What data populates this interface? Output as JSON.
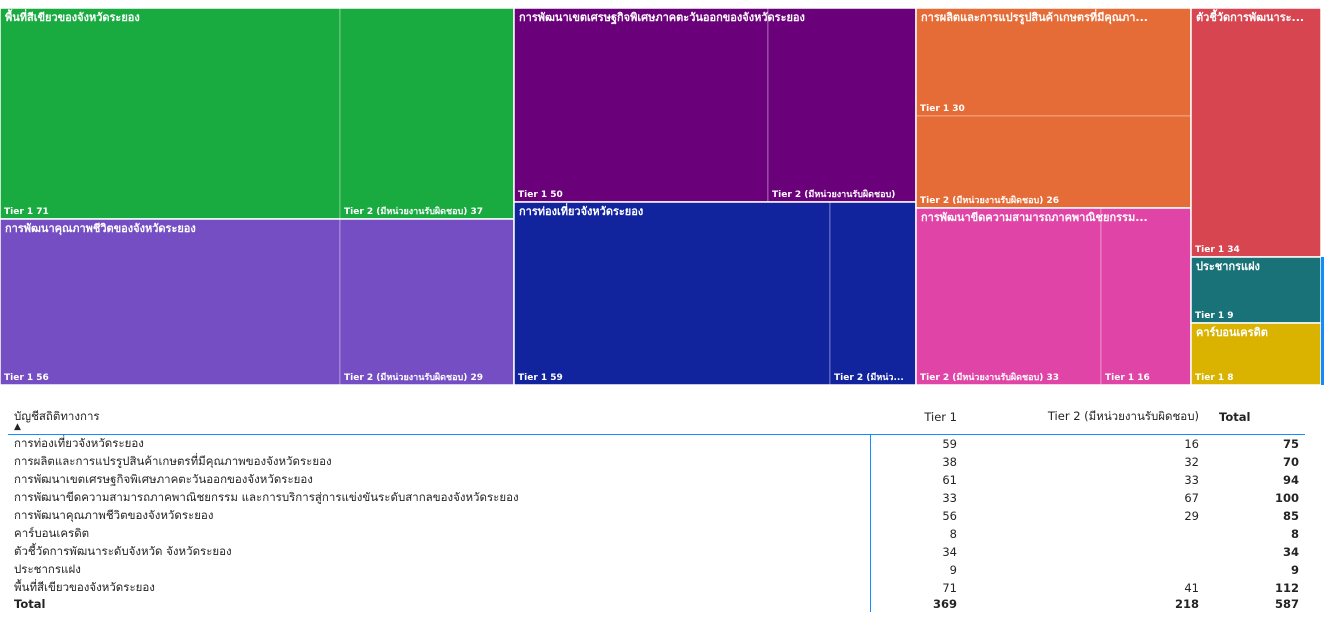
{
  "chart_data": [
    {
      "type": "treemap",
      "groups": [
        {
          "name": "พื้นที่สีเขียวของจังหวัดระยอง",
          "display_label": "พื้นที่สีเขียวของจังหวัดระยอง",
          "color": "#1aab40",
          "tiers": [
            {
              "label": "Tier 1 71",
              "value": 71
            },
            {
              "label": "Tier 2 (มีหน่วยงานรับผิดชอบ) 37",
              "value": 41
            }
          ]
        },
        {
          "name": "การพัฒนาคุณภาพชีวิตของจังหวัดระยอง",
          "display_label": "การพัฒนาคุณภาพชีวิตของจังหวัดระยอง",
          "color": "#744ec2",
          "tiers": [
            {
              "label": "Tier 1 56",
              "value": 56
            },
            {
              "label": "Tier 2 (มีหน่วยงานรับผิดชอบ) 29",
              "value": 29
            }
          ]
        },
        {
          "name": "การพัฒนาเขตเศรษฐกิจพิเศษภาคตะวันออกของจังหวัดระยอง",
          "display_label": "การพัฒนาเขตเศรษฐกิจพิเศษภาคตะวันออกของจังหวัดระยอง",
          "color": "#6b007b",
          "tiers": [
            {
              "label": "Tier 1 50",
              "value": 61
            },
            {
              "label": "Tier 2 (มีหน่วยงานรับผิดชอบ)",
              "value": 33
            }
          ]
        },
        {
          "name": "การท่องเที่ยวจังหวัดระยอง",
          "display_label": "การท่องเที่ยวจังหวัดระยอง",
          "color": "#12239e",
          "tiers": [
            {
              "label": "Tier 1 59",
              "value": 59
            },
            {
              "label": "Tier 2 (มีหน่ว...",
              "value": 16
            }
          ]
        },
        {
          "name": "การผลิตและการแปรรูปสินค้าเกษตรที่มีคุณภาพของจังหวัดระยอง",
          "display_label": "การผลิตและการแปรรูปสินค้าเกษตรที่มีคุณภา...",
          "color": "#e66c37",
          "tiers": [
            {
              "label": "Tier 1 30",
              "value": 38
            },
            {
              "label": "Tier 2 (มีหน่วยงานรับผิดชอบ) 26",
              "value": 32
            }
          ]
        },
        {
          "name": "การพัฒนาขีดความสามารถภาคพาณิชยกรรม และการบริการสู่การแข่งขันระดับสากลของจังหวัดระยอง",
          "display_label": "การพัฒนาขีดความสามารถภาคพาณิชยกรรม...",
          "color": "#e044a7",
          "tiers": [
            {
              "label": "Tier 2 (มีหน่วยงานรับผิดชอบ) 33",
              "value": 67
            },
            {
              "label": "Tier 1 16",
              "value": 33
            }
          ]
        },
        {
          "name": "ตัวชี้วัดการพัฒนาระดับจังหวัด จังหวัดระยอง",
          "display_label": "ตัวชี้วัดการพัฒนาระ...",
          "color": "#d64550",
          "tiers": [
            {
              "label": "Tier 1 34",
              "value": 34
            }
          ]
        },
        {
          "name": "ประชากรแฝง",
          "display_label": "ประชากรแฝง",
          "color": "#197278",
          "tiers": [
            {
              "label": "Tier 1 9",
              "value": 9
            }
          ]
        },
        {
          "name": "คาร์บอนเครดิต",
          "display_label": "คาร์บอนเครดิต",
          "color": "#d9b300",
          "tiers": [
            {
              "label": "Tier 1 8",
              "value": 8
            }
          ]
        }
      ]
    },
    {
      "type": "table",
      "columns": [
        "บัญชีสถิติทางการ",
        "Tier 1",
        "Tier 2 (มีหน่วยงานรับผิดชอบ)",
        "Total"
      ],
      "rows": [
        [
          "การท่องเที่ยวจังหวัดระยอง",
          "59",
          "16",
          "75"
        ],
        [
          "การผลิตและการแปรรูปสินค้าเกษตรที่มีคุณภาพของจังหวัดระยอง",
          "38",
          "32",
          "70"
        ],
        [
          "การพัฒนาเขตเศรษฐกิจพิเศษภาคตะวันออกของจังหวัดระยอง",
          "61",
          "33",
          "94"
        ],
        [
          "การพัฒนาขีดความสามารถภาคพาณิชยกรรม และการบริการสู่การแข่งขันระดับสากลของจังหวัดระยอง",
          "33",
          "67",
          "100"
        ],
        [
          "การพัฒนาคุณภาพชีวิตของจังหวัดระยอง",
          "56",
          "29",
          "85"
        ],
        [
          "คาร์บอนเครดิต",
          "8",
          "",
          "8"
        ],
        [
          "ตัวชี้วัดการพัฒนาระดับจังหวัด จังหวัดระยอง",
          "34",
          "",
          "34"
        ],
        [
          "ประชากรแฝง",
          "9",
          "",
          "9"
        ],
        [
          "พื้นที่สีเขียวของจังหวัดระยอง",
          "71",
          "41",
          "112"
        ]
      ],
      "total_row": [
        "Total",
        "369",
        "218",
        "587"
      ]
    }
  ]
}
